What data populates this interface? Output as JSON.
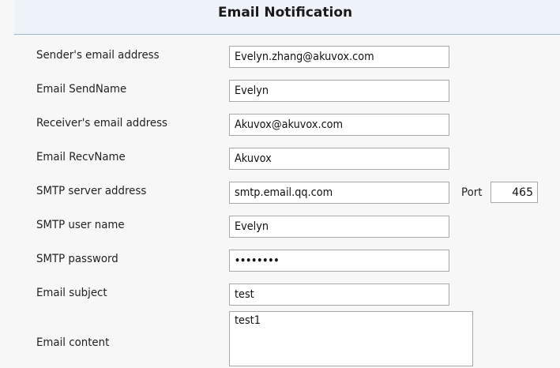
{
  "header": {
    "title": "Email Notification"
  },
  "form": {
    "sender_email": {
      "label": "Sender's email address",
      "value": "Evelyn.zhang@akuvox.com"
    },
    "send_name": {
      "label": "Email SendName",
      "value": "Evelyn"
    },
    "receiver_email": {
      "label": "Receiver's email address",
      "value": "Akuvox@akuvox.com"
    },
    "recv_name": {
      "label": "Email RecvName",
      "value": "Akuvox"
    },
    "smtp_server": {
      "label": "SMTP server address",
      "value": "smtp.email.qq.com",
      "port_label": "Port",
      "port_value": "465"
    },
    "smtp_user": {
      "label": "SMTP user name",
      "value": "Evelyn"
    },
    "smtp_password": {
      "label": "SMTP password",
      "value": "••••••••"
    },
    "subject": {
      "label": "Email subject",
      "value": "test"
    },
    "content": {
      "label": "Email content",
      "value": "test1"
    }
  }
}
